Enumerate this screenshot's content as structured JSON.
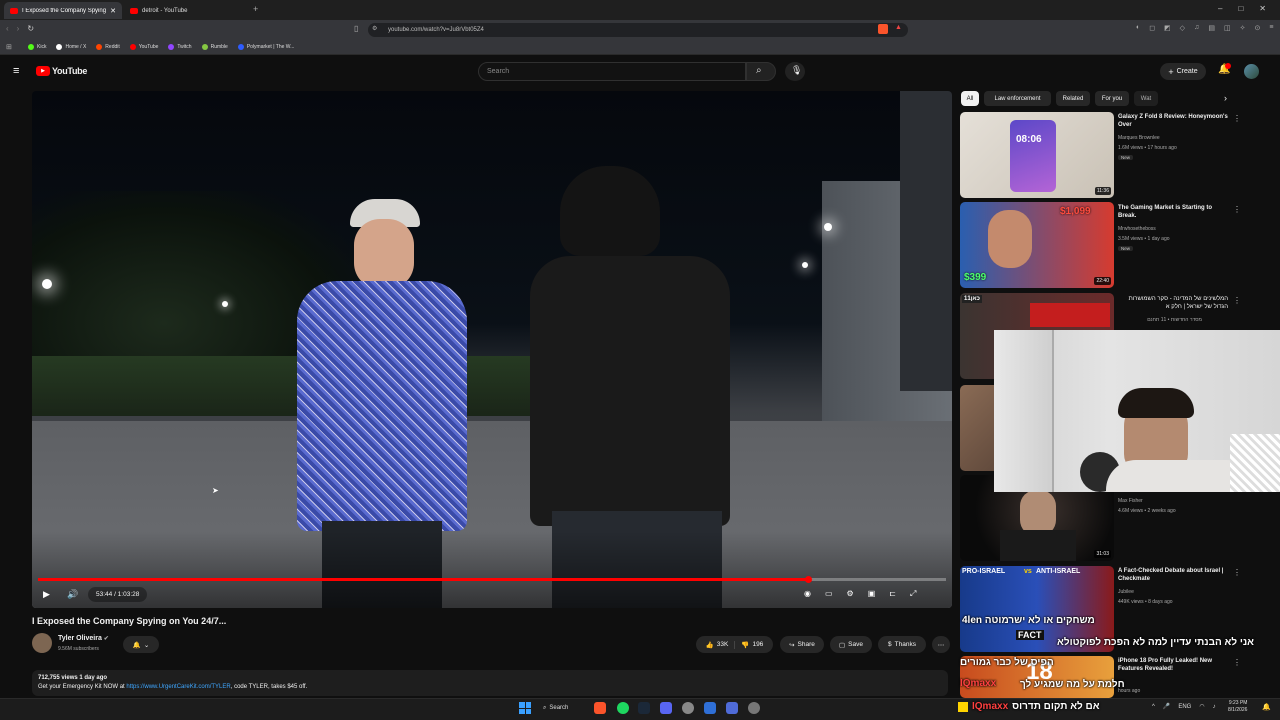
{
  "browser": {
    "tabs": [
      {
        "label": "I Exposed the Company Spying"
      },
      {
        "label": "detroit - YouTube"
      }
    ],
    "url": "youtube.com/watch?v=Ju8rVbt05Z4",
    "bookmarks": [
      "Kick",
      "Home / X",
      "Reddit",
      "YouTube",
      "Twitch",
      "Rumble",
      "Polymarket | The W..."
    ]
  },
  "youtube": {
    "logo": "YouTube",
    "search_placeholder": "Search",
    "create_label": "Create"
  },
  "video": {
    "time": "53:44 / 1:03:28",
    "progress_fraction": 0.848,
    "title": "I Exposed the Company Spying on You 24/7...",
    "channel": "Tyler Oliveira",
    "subscribers": "9.56M subscribers",
    "likes": "33K",
    "comments": "196",
    "share": "Share",
    "save": "Save",
    "thanks": "Thanks",
    "views_date": "712,755 views  1 day ago",
    "desc_prefix": "Get your Emergency Kit NOW at ",
    "desc_link": "https://www.UrgentCareKit.com/TYLER",
    "desc_suffix": ", code TYLER, takes $45 off."
  },
  "chips": [
    "All",
    "Law enforcement",
    "Related",
    "For you",
    "Wat"
  ],
  "recommendations": [
    {
      "title": "Galaxy Z Fold 8 Review: Honeymoon's Over",
      "channel": "Marques Brownlee",
      "meta": "1.6M views • 17 hours ago",
      "badge": "New",
      "duration": "11:36",
      "thumb_text": "08:06"
    },
    {
      "title": "The Gaming Market is Starting to Break.",
      "channel": "Mrwhosetheboss",
      "meta": "3.5M views • 1 day ago",
      "badge": "New",
      "duration": "22:40",
      "thumb_price_a": "$1,099",
      "thumb_price_b": "$399"
    },
    {
      "title": "המלשינים של המדינה - סקר השמושרות הגדול של ישראל | חלק א",
      "channel": "מסדר החדשות",
      "meta": "11 תחנם",
      "badge": "",
      "duration": "",
      "thumb_text": "כאן11"
    },
    {
      "title": "",
      "channel": "Max Fisher",
      "meta": "4.6M views • 2 weeks ago",
      "badge": "",
      "duration": "31:03"
    },
    {
      "title": "A Fact-Checked Debate about Israel | Checkmate",
      "channel": "Jubilee",
      "meta": "449K views • 8 days ago",
      "badge": "",
      "duration": "",
      "thumb_left": "PRO-ISRAEL",
      "thumb_vs": "vs",
      "thumb_right": "ANTI-ISRAEL",
      "thumb_fact": "FACT"
    },
    {
      "title": "iPhone 18 Pro Fully Leaked! New Features Revealed!",
      "channel": "",
      "meta": "hours ago",
      "badge": "",
      "duration": "",
      "thumb_text": "18"
    }
  ],
  "overlay_texts": [
    "משחקים או לא ישרמוטה 4len",
    "אני לא הבנתי עדיין למה לא הפכת לפוקטולא",
    "הפיס של כבר גמורים",
    "חלמת על מה שמגיע לך",
    "IQmaxx",
    "אם לא תקום תדרוס"
  ],
  "taskbar": {
    "search": "Search",
    "lang": "ENG",
    "time": "9:23 PM",
    "date": "8/1/2026"
  },
  "colors": {
    "brand_red": "#ff0000",
    "background": "#0f0f0f",
    "link": "#3ea6ff"
  }
}
